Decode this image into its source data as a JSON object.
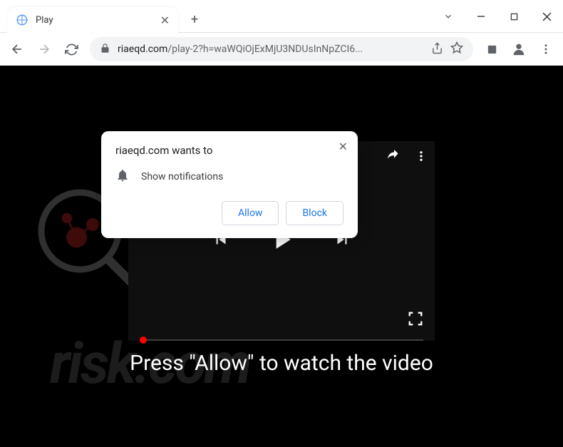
{
  "tab": {
    "title": "Play"
  },
  "url": {
    "domain": "riaeqd.com",
    "path": "/play-2?h=waWQiOjExMjU3NDUsInNpZCI6..."
  },
  "popup": {
    "title": "riaeqd.com wants to",
    "permission": "Show notifications",
    "allow": "Allow",
    "block": "Block"
  },
  "instruction": "Press \"Allow\" to watch the video",
  "watermark": "risk.com"
}
